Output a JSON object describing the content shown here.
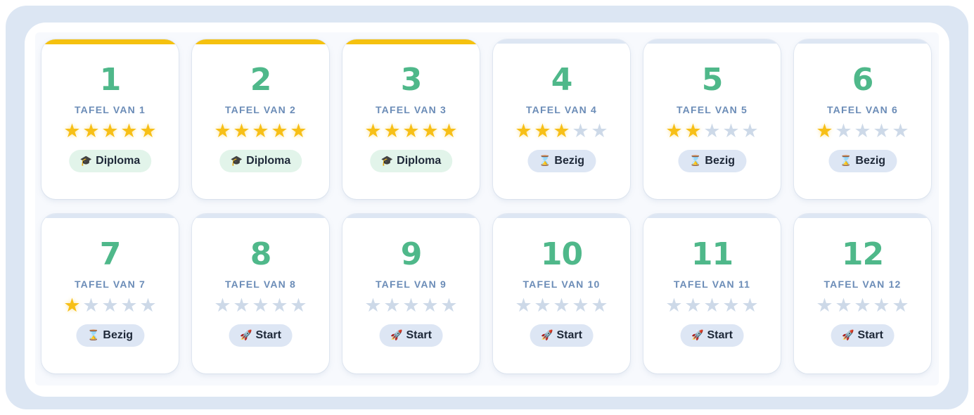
{
  "colors": {
    "accent_green": "#4fb88a",
    "label_blue": "#6b8cb7",
    "star_on": "#f7bf16",
    "star_off": "#cdd9e8",
    "completed_bar": "#f5c10f",
    "diploma_badge_bg": "#e2f4ea",
    "status_badge_bg": "#dde6f4"
  },
  "star_glyph": "★",
  "cards": [
    {
      "number": "1",
      "label": "TAFEL VAN 1",
      "stars": 5,
      "status": "diploma",
      "badge_icon": "graduation-cap-icon",
      "badge_glyph": "🎓",
      "badge_label": "Diploma"
    },
    {
      "number": "2",
      "label": "TAFEL VAN 2",
      "stars": 5,
      "status": "diploma",
      "badge_icon": "graduation-cap-icon",
      "badge_glyph": "🎓",
      "badge_label": "Diploma"
    },
    {
      "number": "3",
      "label": "TAFEL VAN 3",
      "stars": 5,
      "status": "diploma",
      "badge_icon": "graduation-cap-icon",
      "badge_glyph": "🎓",
      "badge_label": "Diploma"
    },
    {
      "number": "4",
      "label": "TAFEL VAN 4",
      "stars": 3,
      "status": "bezig",
      "badge_icon": "hourglass-icon",
      "badge_glyph": "⌛",
      "badge_label": "Bezig"
    },
    {
      "number": "5",
      "label": "TAFEL VAN 5",
      "stars": 2,
      "status": "bezig",
      "badge_icon": "hourglass-icon",
      "badge_glyph": "⌛",
      "badge_label": "Bezig"
    },
    {
      "number": "6",
      "label": "TAFEL VAN 6",
      "stars": 1,
      "status": "bezig",
      "badge_icon": "hourglass-icon",
      "badge_glyph": "⌛",
      "badge_label": "Bezig"
    },
    {
      "number": "7",
      "label": "TAFEL VAN 7",
      "stars": 1,
      "status": "bezig",
      "badge_icon": "hourglass-icon",
      "badge_glyph": "⌛",
      "badge_label": "Bezig"
    },
    {
      "number": "8",
      "label": "TAFEL VAN 8",
      "stars": 0,
      "status": "start",
      "badge_icon": "rocket-icon",
      "badge_glyph": "🚀",
      "badge_label": "Start"
    },
    {
      "number": "9",
      "label": "TAFEL VAN 9",
      "stars": 0,
      "status": "start",
      "badge_icon": "rocket-icon",
      "badge_glyph": "🚀",
      "badge_label": "Start"
    },
    {
      "number": "10",
      "label": "TAFEL VAN 10",
      "stars": 0,
      "status": "start",
      "badge_icon": "rocket-icon",
      "badge_glyph": "🚀",
      "badge_label": "Start"
    },
    {
      "number": "11",
      "label": "TAFEL VAN 11",
      "stars": 0,
      "status": "start",
      "badge_icon": "rocket-icon",
      "badge_glyph": "🚀",
      "badge_label": "Start"
    },
    {
      "number": "12",
      "label": "TAFEL VAN 12",
      "stars": 0,
      "status": "start",
      "badge_icon": "rocket-icon",
      "badge_glyph": "🚀",
      "badge_label": "Start"
    }
  ],
  "max_stars": 5
}
